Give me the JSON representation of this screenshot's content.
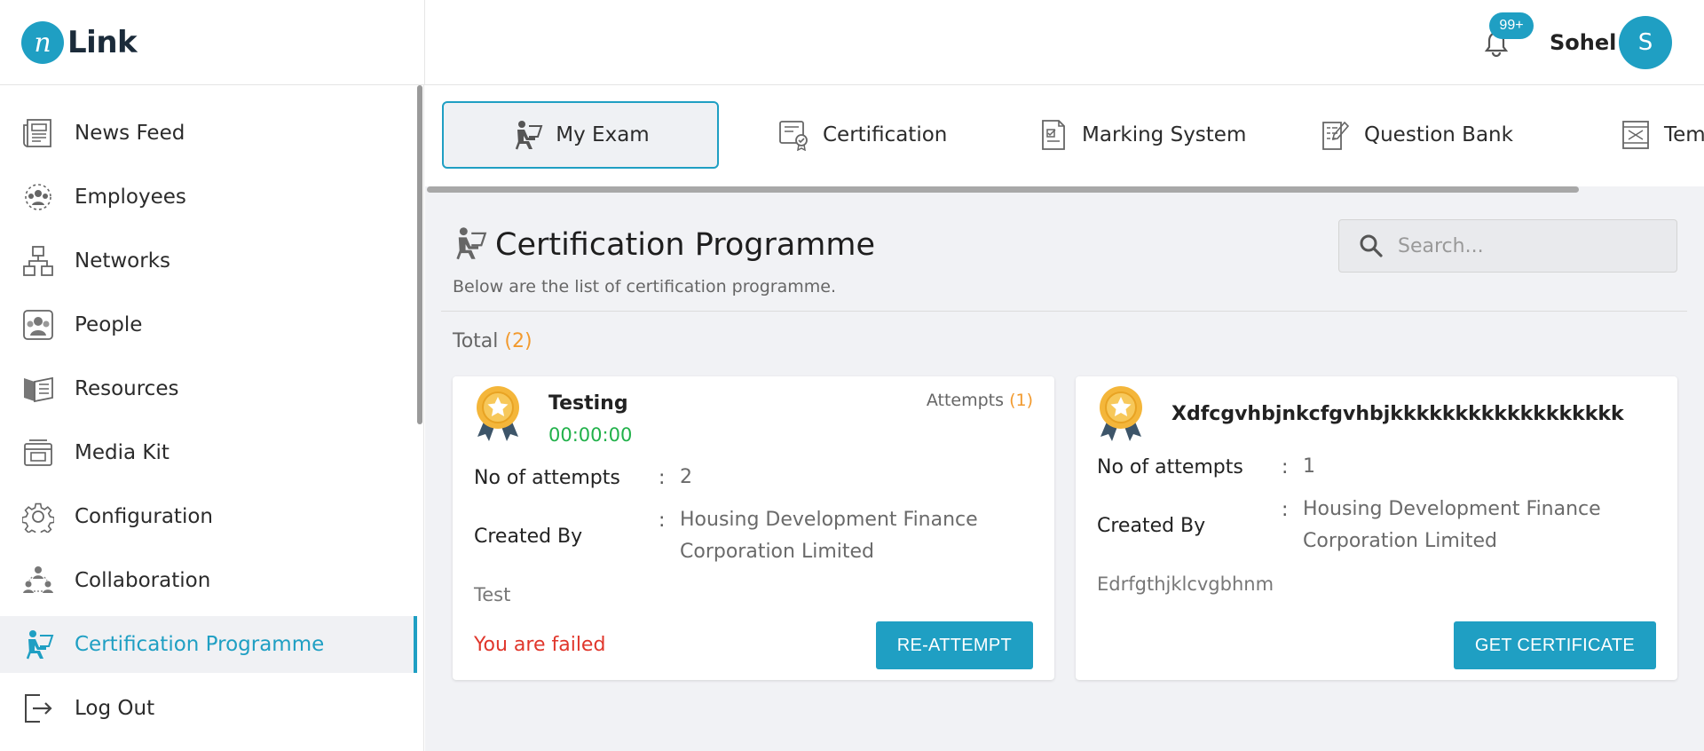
{
  "app": {
    "logo_letter": "n",
    "logo_text": "Link",
    "notification_badge": "99+",
    "user_name": "Sohel",
    "avatar_initial": "S",
    "accent_color": "#1f9fc3"
  },
  "sidebar": {
    "items": [
      {
        "label": "News Feed",
        "icon": "newspaper-icon"
      },
      {
        "label": "Employees",
        "icon": "employees-icon"
      },
      {
        "label": "Networks",
        "icon": "network-icon"
      },
      {
        "label": "People",
        "icon": "people-icon"
      },
      {
        "label": "Resources",
        "icon": "book-icon"
      },
      {
        "label": "Media Kit",
        "icon": "media-kit-icon"
      },
      {
        "label": "Configuration",
        "icon": "gear-icon"
      },
      {
        "label": "Collaboration",
        "icon": "collaboration-icon"
      },
      {
        "label": "Certification Programme",
        "icon": "exam-person-icon",
        "active": true
      },
      {
        "label": "Log Out",
        "icon": "logout-icon"
      }
    ]
  },
  "tabs": [
    {
      "label": "My Exam",
      "icon": "exam-person-icon",
      "active": true
    },
    {
      "label": "Certification",
      "icon": "certificate-icon"
    },
    {
      "label": "Marking System",
      "icon": "marking-doc-icon"
    },
    {
      "label": "Question Bank",
      "icon": "question-doc-icon"
    },
    {
      "label": "Temp",
      "icon": "template-icon"
    }
  ],
  "page": {
    "title": "Certification Programme",
    "subtitle": "Below are the list of certification programme.",
    "search_placeholder": "Search...",
    "total_label": "Total",
    "total_count": "(2)"
  },
  "cards": [
    {
      "title": "Testing",
      "timer": "00:00:00",
      "attempts_label": "Attempts",
      "attempts_count": "(1)",
      "no_of_attempts_label": "No of attempts",
      "no_of_attempts_value": "2",
      "created_by_label": "Created By",
      "created_by_value": "Housing Development Finance Corporation Limited",
      "colon": ":",
      "description": "Test",
      "status": "You are failed",
      "button": "RE-ATTEMPT"
    },
    {
      "title": "Xdfcgvhbjnkcfgvhbjkkkkkkkkkkkkkkkkkk",
      "no_of_attempts_label": "No of attempts",
      "no_of_attempts_value": "1",
      "created_by_label": "Created By",
      "created_by_value": "Housing Development Finance Corporation Limited",
      "colon": ":",
      "description": "Edrfgthjklcvgbhnm",
      "button": "GET CERTIFICATE"
    }
  ]
}
